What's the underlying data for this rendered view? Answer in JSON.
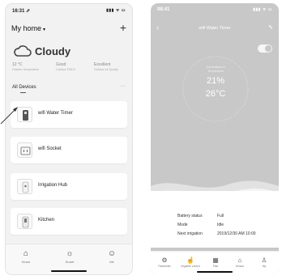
{
  "left": {
    "status": {
      "time": "16:31 ⇗",
      "icons": "▮▮▮ ᯤ ▭"
    },
    "header": {
      "title": "My home",
      "add_label": "+"
    },
    "weather": {
      "condition": "Cloudy",
      "stats": [
        {
          "value": "12 °C",
          "label": "Outdoor Temperature"
        },
        {
          "value": "Good",
          "label": "Outdoor PM2.5"
        },
        {
          "value": "Excellent",
          "label": "Outdoor Air Quality"
        }
      ]
    },
    "devices_header": {
      "title": "All Devices",
      "more": "···"
    },
    "devices": [
      {
        "name": "wifi Water Timer"
      },
      {
        "name": "wifi Socket"
      },
      {
        "name": "Irrigation Hub"
      },
      {
        "name": "Kitchen"
      }
    ],
    "tabs": [
      {
        "label": "Home",
        "icon": "home-icon"
      },
      {
        "label": "Smart",
        "icon": "sun-icon"
      },
      {
        "label": "Me",
        "icon": "user-circle-icon"
      }
    ]
  },
  "right": {
    "status": {
      "time": "08:41",
      "icons": "▮▮▮ ᯤ ▭"
    },
    "header": {
      "title": "wifi Water Timer"
    },
    "gauge": {
      "label_line1": "Soil Moisture &",
      "label_line2": "Temperature",
      "humidity": "21%",
      "temperature": "26°C"
    },
    "info": [
      {
        "label": "Battery status",
        "value": "Full"
      },
      {
        "label": "Mode",
        "value": "Idle"
      },
      {
        "label": "Next irrigation",
        "value": "2019/12/30 AM 10:00"
      }
    ],
    "tabs": [
      {
        "label": "Parameter",
        "icon": "gear-icon"
      },
      {
        "label": "Irrigation control",
        "icon": "hand-icon"
      },
      {
        "label": "Plan",
        "icon": "calendar-icon"
      },
      {
        "label": "Sensor",
        "icon": "sensor-icon"
      },
      {
        "label": "My",
        "icon": "person-icon"
      }
    ]
  },
  "colors": {
    "right_background": "#c8c8c8",
    "left_background": "#f2f2f2"
  }
}
